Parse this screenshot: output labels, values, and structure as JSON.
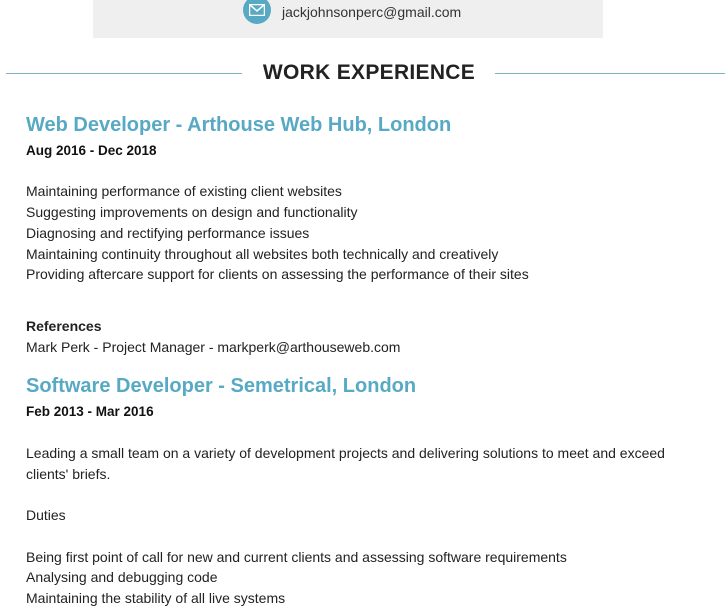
{
  "contact": {
    "email": "jackjohnsonperc@gmail.com",
    "email_icon": "envelope-icon"
  },
  "section": {
    "title": "WORK EXPERIENCE"
  },
  "jobs": [
    {
      "title": "Web Developer - Arthouse Web Hub, London",
      "dates": "Aug 2016 - Dec 2018",
      "duties": [
        "Maintaining performance of existing client websites",
        "Suggesting improvements on design and functionality",
        "Diagnosing and rectifying performance issues",
        "Maintaining continuity throughout all websites both technically and creatively",
        "Providing aftercare support for clients on assessing the performance of their sites"
      ],
      "references_label": "References",
      "reference": "Mark Perk - Project Manager - markperk@arthouseweb.com"
    },
    {
      "title": "Software Developer - Semetrical, London",
      "dates": "Feb 2013 - Mar 2016",
      "summary_line1": "Leading a small team on a variety of development projects and delivering solutions to meet and exceed",
      "summary_line2": "clients' briefs.",
      "duties_label": "Duties",
      "duties": [
        "Being first point of call for new and current clients and assessing software requirements",
        "Analysing and debugging code",
        "Maintaining the stability of all live systems"
      ]
    }
  ],
  "colors": {
    "accent": "#57a9c4",
    "rule": "#7fb4c8",
    "contact_bar": "#efefef"
  }
}
